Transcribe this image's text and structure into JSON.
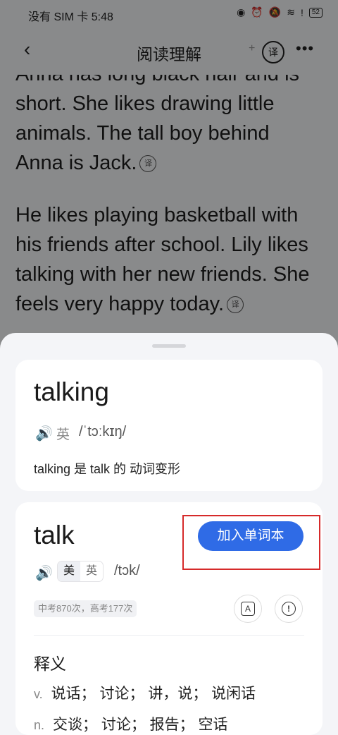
{
  "status_bar": {
    "text": "没有 SIM 卡 5:48",
    "battery": "52"
  },
  "nav": {
    "title": "阅读理解",
    "translate_icon": "译"
  },
  "article": {
    "paragraph1": "Anna has long black hair and is short. She likes drawing little animals. The tall boy behind Anna is Jack.",
    "paragraph2": "He likes playing basketball with his friends after school. Lily likes talking with her new friends. She feels very happy today.",
    "translate_icon": "译"
  },
  "word_card": {
    "word": "talking",
    "accent": "英",
    "phonetic": "/ˈtɔːkɪŋ/",
    "form_note": "talking 是 talk 的 动词变形"
  },
  "base_card": {
    "word": "talk",
    "add_button": "加入单词本",
    "accent_us": "美",
    "accent_uk": "英",
    "phonetic": "/tɔk/",
    "frequency": "中考870次，高考177次",
    "definitions_title": "释义",
    "definitions": [
      {
        "pos": "v.",
        "text": "说话；  讨论；  讲，说；  说闲话"
      },
      {
        "pos": "n.",
        "text": "交谈；  讨论；  报告；  空话"
      }
    ]
  },
  "colors": {
    "accent": "#2f6be6",
    "highlight_box": "#d62a2a"
  }
}
